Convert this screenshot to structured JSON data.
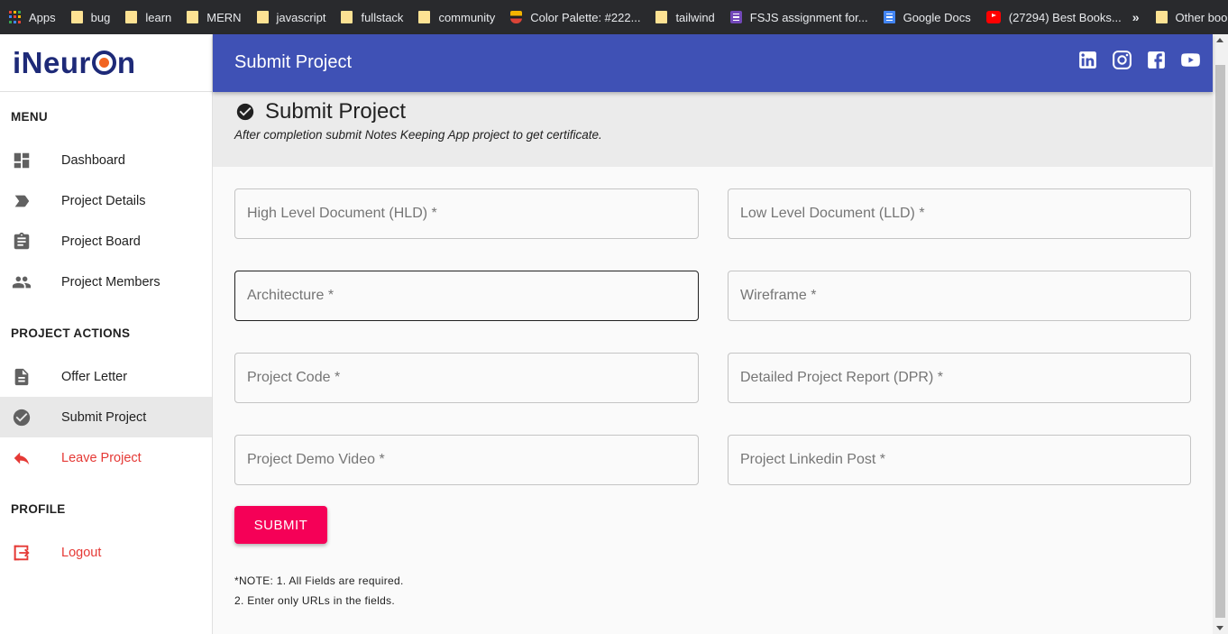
{
  "bookmarks": {
    "items": [
      {
        "label": "Apps",
        "icon": "apps-grid-icon"
      },
      {
        "label": "bug",
        "icon": "folder-icon"
      },
      {
        "label": "learn",
        "icon": "folder-icon"
      },
      {
        "label": "MERN",
        "icon": "folder-icon"
      },
      {
        "label": "javascript",
        "icon": "folder-icon"
      },
      {
        "label": "fullstack",
        "icon": "folder-icon"
      },
      {
        "label": "community",
        "icon": "folder-icon"
      },
      {
        "label": "Color Palette: #222...",
        "icon": "color-palette-icon"
      },
      {
        "label": "tailwind",
        "icon": "folder-icon"
      },
      {
        "label": "FSJS assignment for...",
        "icon": "forms-icon"
      },
      {
        "label": "Google Docs",
        "icon": "google-docs-icon"
      },
      {
        "label": "(27294) Best Books...",
        "icon": "youtube-icon"
      }
    ],
    "overflow": "»",
    "other": "Other bookmarks"
  },
  "brand": {
    "logo_prefix": "iNeur",
    "logo_suffix": "n"
  },
  "sidebar": {
    "menu_title": "MENU",
    "menu_items": [
      {
        "label": "Dashboard",
        "icon": "dashboard-icon"
      },
      {
        "label": "Project Details",
        "icon": "label-icon"
      },
      {
        "label": "Project Board",
        "icon": "clipboard-icon"
      },
      {
        "label": "Project Members",
        "icon": "people-icon"
      }
    ],
    "actions_title": "PROJECT ACTIONS",
    "action_items": [
      {
        "label": "Offer Letter",
        "icon": "document-icon"
      },
      {
        "label": "Submit Project",
        "icon": "check-circle-icon",
        "active": true
      },
      {
        "label": "Leave Project",
        "icon": "reply-icon",
        "danger": true
      }
    ],
    "profile_title": "PROFILE",
    "profile_items": [
      {
        "label": "Logout",
        "icon": "logout-icon",
        "danger": true
      }
    ]
  },
  "header": {
    "title": "Submit Project",
    "social": [
      "linkedin-icon",
      "instagram-icon",
      "facebook-icon",
      "youtube-icon"
    ]
  },
  "banner": {
    "title": "Submit Project",
    "subtitle": "After completion submit Notes Keeping App project to get certificate."
  },
  "form": {
    "fields": [
      {
        "placeholder": "High Level Document (HLD) *",
        "value": ""
      },
      {
        "placeholder": "Low Level Document (LLD) *",
        "value": ""
      },
      {
        "placeholder": "Architecture *",
        "value": "",
        "focused": true
      },
      {
        "placeholder": "Wireframe *",
        "value": ""
      },
      {
        "placeholder": "Project Code *",
        "value": ""
      },
      {
        "placeholder": "Detailed Project Report (DPR) *",
        "value": ""
      },
      {
        "placeholder": "Project Demo Video *",
        "value": ""
      },
      {
        "placeholder": "Project Linkedin Post *",
        "value": ""
      }
    ],
    "submit_label": "SUBMIT",
    "note_line1": "*NOTE: 1. All Fields are required.",
    "note_line2": "2. Enter only URLs in the fields."
  },
  "colors": {
    "appbar": "#3f51b5",
    "submit": "#f50057",
    "danger": "#e53935",
    "bookmark_bar": "#292a2d"
  }
}
